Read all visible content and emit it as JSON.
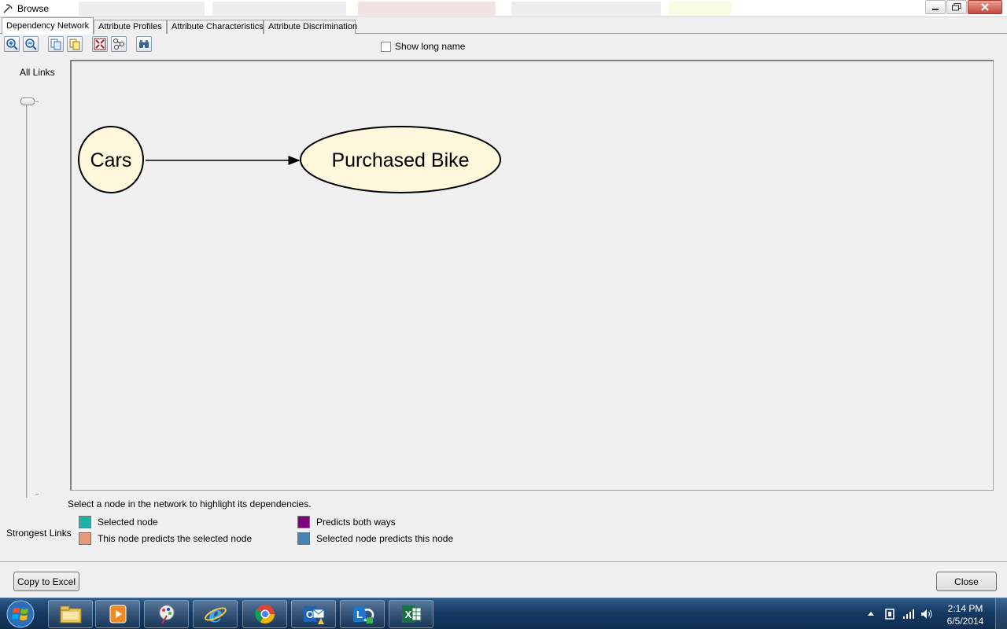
{
  "window": {
    "title": "Browse",
    "background_tabs": [
      "",
      "",
      "",
      "",
      ""
    ]
  },
  "tabs": [
    {
      "label": "Dependency Network",
      "active": true
    },
    {
      "label": "Attribute Profiles",
      "active": false
    },
    {
      "label": "Attribute Characteristics",
      "active": false
    },
    {
      "label": "Attribute Discrimination",
      "active": false
    }
  ],
  "toolbar": {
    "buttons": [
      "zoom-in-icon",
      "zoom-out-icon",
      "copy-icon",
      "copy-graph-icon",
      "size-to-fit-icon",
      "center-graph-icon",
      "find-node-icon"
    ],
    "show_long_name_label": "Show long name",
    "show_long_name_checked": false
  },
  "slider": {
    "top_label": "All Links",
    "bottom_label": "Strongest Links",
    "position": 0
  },
  "network": {
    "nodes": [
      {
        "id": "cars",
        "label": "Cars",
        "fill": "#fff8dc"
      },
      {
        "id": "purchased_bike",
        "label": "Purchased Bike",
        "fill": "#fff8dc"
      }
    ],
    "edges": [
      {
        "from": "cars",
        "to": "purchased_bike"
      }
    ]
  },
  "hint": "Select a node in the network to highlight its dependencies.",
  "legend": [
    {
      "label": "Selected node",
      "color": "#20b2aa"
    },
    {
      "label": "This node predicts the selected node",
      "color": "#e9967a"
    },
    {
      "label": "Predicts both ways",
      "color": "#800080"
    },
    {
      "label": "Selected node predicts this node",
      "color": "#4682b4"
    }
  ],
  "buttons": {
    "copy_to_excel": "Copy to Excel",
    "close": "Close"
  },
  "taskbar": {
    "apps": [
      "file-explorer-icon",
      "media-player-icon",
      "paint-icon",
      "internet-explorer-icon",
      "chrome-icon",
      "outlook-icon",
      "lync-icon",
      "excel-icon"
    ],
    "time": "2:14 PM",
    "date": "6/5/2014"
  }
}
